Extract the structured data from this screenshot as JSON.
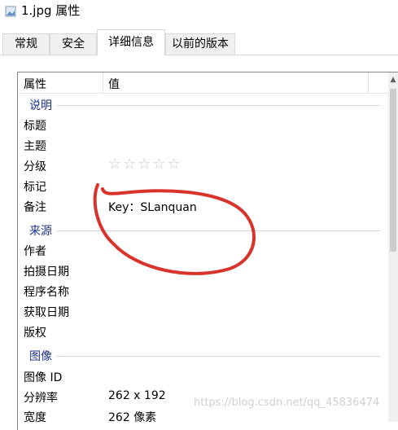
{
  "window": {
    "title": "1.jpg 属性"
  },
  "tabs": [
    {
      "label": "常规"
    },
    {
      "label": "安全"
    },
    {
      "label": "详细信息",
      "active": true
    },
    {
      "label": "以前的版本"
    }
  ],
  "table": {
    "header": {
      "property": "属性",
      "value": "值"
    },
    "sections": [
      {
        "title": "说明",
        "rows": [
          {
            "key": "标题",
            "value": ""
          },
          {
            "key": "主题",
            "value": ""
          },
          {
            "key": "分级",
            "value": "☆☆☆☆☆"
          },
          {
            "key": "标记",
            "value": ""
          },
          {
            "key": "备注",
            "value": "Key：SLanquan"
          }
        ]
      },
      {
        "title": "来源",
        "rows": [
          {
            "key": "作者",
            "value": ""
          },
          {
            "key": "拍摄日期",
            "value": ""
          },
          {
            "key": "程序名称",
            "value": ""
          },
          {
            "key": "获取日期",
            "value": ""
          },
          {
            "key": "版权",
            "value": ""
          }
        ]
      },
      {
        "title": "图像",
        "rows": [
          {
            "key": "图像 ID",
            "value": ""
          },
          {
            "key": "分辨率",
            "value": "262 x 192"
          },
          {
            "key": "宽度",
            "value": "262 像素"
          }
        ]
      }
    ]
  },
  "watermark": "https://blog.csdn.net/qq_45836474",
  "colors": {
    "annotation_circle": "#d9342b",
    "section_title": "#1e3287"
  }
}
